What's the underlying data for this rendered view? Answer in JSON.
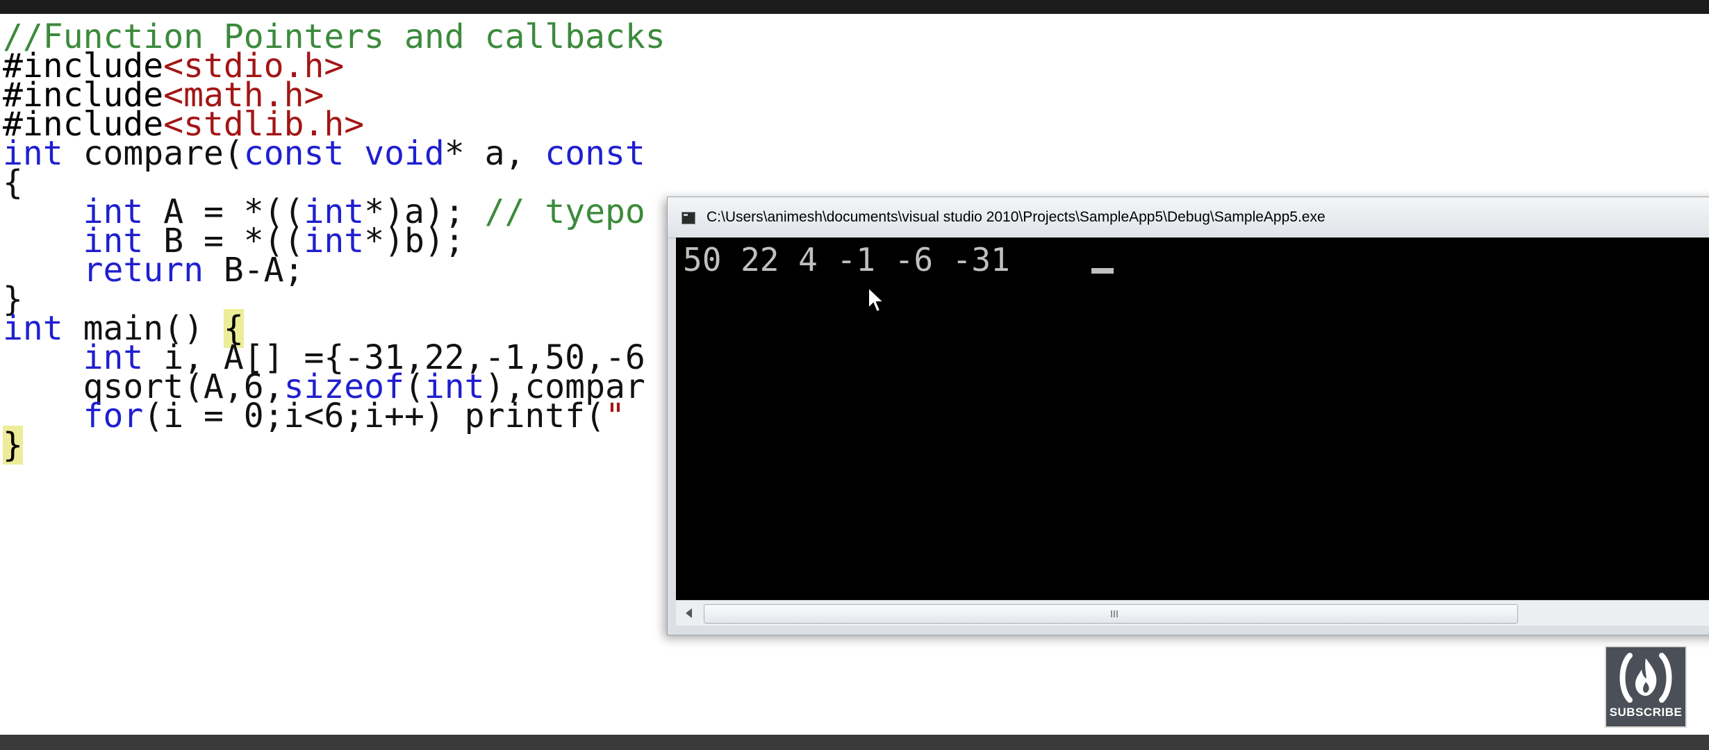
{
  "editor": {
    "code_lines": [
      {
        "segments": [
          {
            "t": "//Function Pointers and callbacks",
            "c": "cm"
          }
        ]
      },
      {
        "segments": [
          {
            "t": "#include",
            "c": "pp"
          },
          {
            "t": "<stdio.h>",
            "c": "st"
          }
        ]
      },
      {
        "segments": [
          {
            "t": "#include",
            "c": "pp"
          },
          {
            "t": "<math.h>",
            "c": "st"
          }
        ]
      },
      {
        "segments": [
          {
            "t": "#include",
            "c": "pp"
          },
          {
            "t": "<stdlib.h>",
            "c": "st"
          }
        ]
      },
      {
        "segments": [
          {
            "t": "int",
            "c": "kw"
          },
          {
            "t": " compare(",
            "c": "tx"
          },
          {
            "t": "const",
            "c": "kw"
          },
          {
            "t": " ",
            "c": "tx"
          },
          {
            "t": "void",
            "c": "kw"
          },
          {
            "t": "* a, ",
            "c": "tx"
          },
          {
            "t": "const",
            "c": "kw"
          }
        ]
      },
      {
        "segments": [
          {
            "t": "{",
            "c": "tx"
          }
        ]
      },
      {
        "segments": [
          {
            "t": "    ",
            "c": "tx"
          },
          {
            "t": "int",
            "c": "kw"
          },
          {
            "t": " A = *((",
            "c": "tx"
          },
          {
            "t": "int",
            "c": "kw"
          },
          {
            "t": "*)a); ",
            "c": "tx"
          },
          {
            "t": "// tyepo",
            "c": "cm"
          }
        ]
      },
      {
        "segments": [
          {
            "t": "    ",
            "c": "tx"
          },
          {
            "t": "int",
            "c": "kw"
          },
          {
            "t": " B = *((",
            "c": "tx"
          },
          {
            "t": "int",
            "c": "kw"
          },
          {
            "t": "*)b);",
            "c": "tx"
          }
        ]
      },
      {
        "segments": [
          {
            "t": "    ",
            "c": "tx"
          },
          {
            "t": "return",
            "c": "kw"
          },
          {
            "t": " B-A;",
            "c": "tx"
          }
        ]
      },
      {
        "segments": [
          {
            "t": "}",
            "c": "tx"
          }
        ]
      },
      {
        "segments": [
          {
            "t": "int",
            "c": "kw"
          },
          {
            "t": " main() ",
            "c": "tx"
          },
          {
            "t": "{",
            "c": "hl"
          }
        ]
      },
      {
        "segments": [
          {
            "t": "    ",
            "c": "tx"
          },
          {
            "t": "int",
            "c": "kw"
          },
          {
            "t": " i, A[] ={-31,22,-1,50,-6",
            "c": "tx"
          }
        ]
      },
      {
        "segments": [
          {
            "t": "    qsort(A,6,",
            "c": "tx"
          },
          {
            "t": "sizeof",
            "c": "kw"
          },
          {
            "t": "(",
            "c": "tx"
          },
          {
            "t": "int",
            "c": "kw"
          },
          {
            "t": "),compar",
            "c": "tx"
          }
        ]
      },
      {
        "segments": [
          {
            "t": "    ",
            "c": "tx"
          },
          {
            "t": "for",
            "c": "kw"
          },
          {
            "t": "(i = 0;i<6;i++) printf(",
            "c": "tx"
          },
          {
            "t": "\"",
            "c": "st"
          }
        ]
      },
      {
        "segments": [
          {
            "t": "}",
            "c": "hl"
          }
        ]
      }
    ]
  },
  "console": {
    "title": "C:\\Users\\animesh\\documents\\visual studio 2010\\Projects\\SampleApp5\\Debug\\SampleApp5.exe",
    "output": "50 22 4 -1 -6 -31"
  },
  "badge": {
    "label": "SUBSCRIBE",
    "icon": "fire-icon"
  },
  "colors": {
    "comment": "#3c8a3c",
    "keyword": "#1f1fd0",
    "string": "#a31515",
    "console_bg": "#000000",
    "console_text": "#c0c0c0"
  }
}
